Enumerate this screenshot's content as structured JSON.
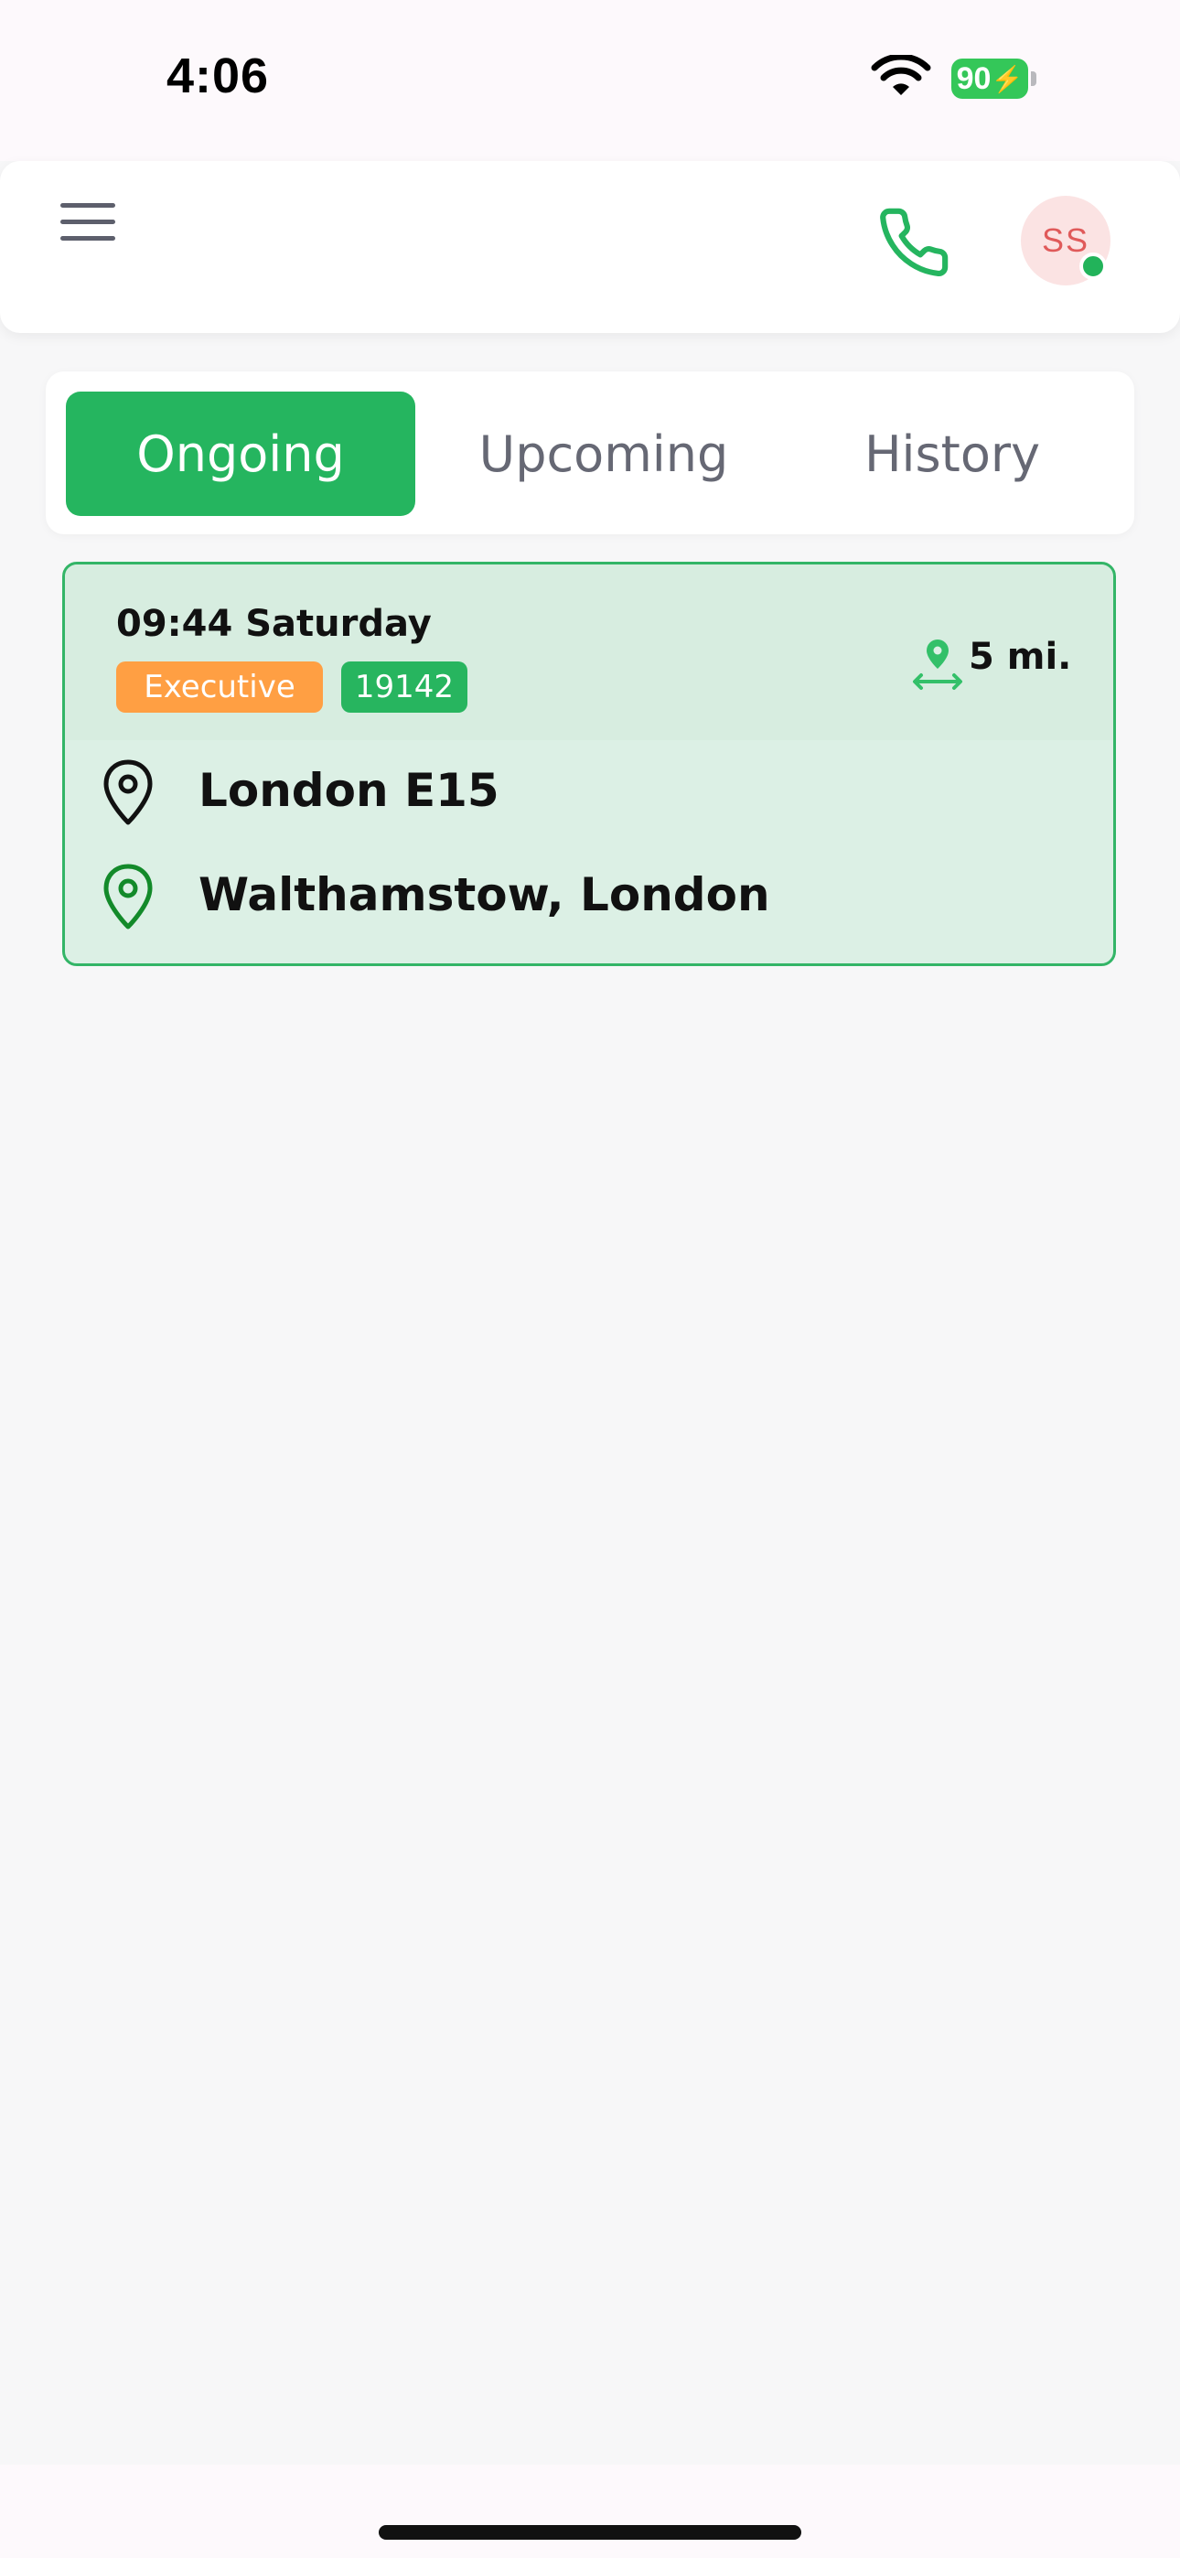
{
  "status_bar": {
    "time": "4:06",
    "battery": "90"
  },
  "header": {
    "menu_icon": "hamburger-menu-icon",
    "call_icon": "phone-icon",
    "avatar_initials": "SS"
  },
  "tabs": [
    {
      "label": "Ongoing",
      "active": true
    },
    {
      "label": "Upcoming",
      "active": false
    },
    {
      "label": "History",
      "active": false
    }
  ],
  "rides": [
    {
      "time": "09:44 Saturday",
      "class": "Executive",
      "id": "19142",
      "distance": "5 mi.",
      "pickup": "London E15",
      "dropoff": "Walthamstow, London"
    }
  ],
  "colors": {
    "accent": "#25b55f",
    "badge_orange": "#ff9f43",
    "card_bg": "#dcf0e5",
    "avatar_bg": "#fbe3e3"
  }
}
